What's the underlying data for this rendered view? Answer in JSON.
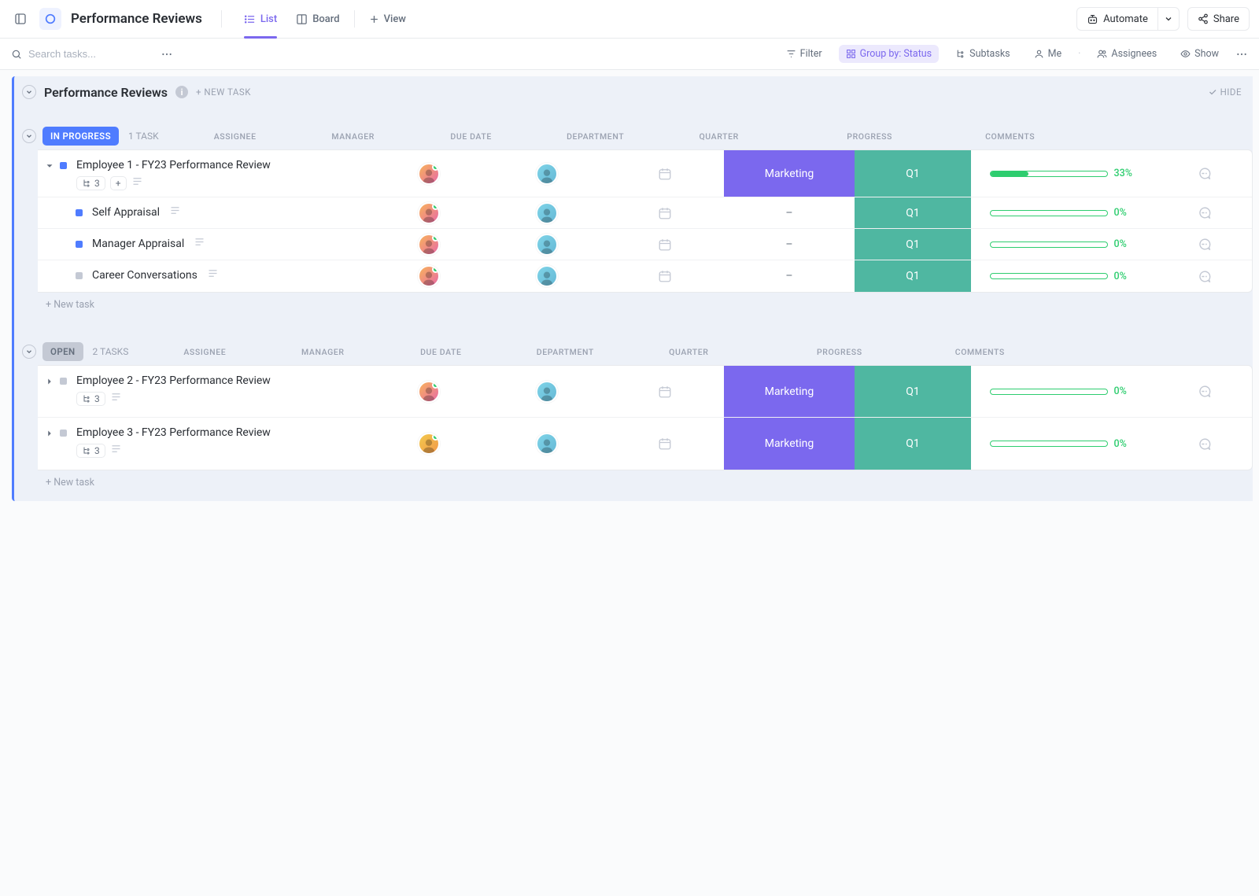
{
  "header": {
    "title": "Performance Reviews",
    "tabs": {
      "list": "List",
      "board": "Board",
      "view": "View"
    },
    "automate": "Automate",
    "share": "Share"
  },
  "toolbar": {
    "search_placeholder": "Search tasks...",
    "filter": "Filter",
    "group": "Group by: Status",
    "subtasks": "Subtasks",
    "me": "Me",
    "assignees": "Assignees",
    "show": "Show"
  },
  "list": {
    "title": "Performance Reviews",
    "new_task": "+ NEW TASK",
    "hide": "HIDE"
  },
  "columns": {
    "assignee": "ASSIGNEE",
    "manager": "MANAGER",
    "due": "DUE DATE",
    "dept": "DEPARTMENT",
    "qtr": "QUARTER",
    "prog": "PROGRESS",
    "comm": "COMMENTS"
  },
  "groups": [
    {
      "status": "IN PROGRESS",
      "color": "#4f7cff",
      "count": "1 TASK",
      "tasks": [
        {
          "name": "Employee 1 - FY23 Performance Review",
          "sub_count": "3",
          "dept": "Marketing",
          "dept_color": "#7b68ee",
          "qtr": "Q1",
          "qtr_color": "#4fb7a1",
          "pct": "33%",
          "pct_w": 33,
          "subs": [
            {
              "name": "Self Appraisal",
              "dept": "–",
              "qtr": "Q1",
              "pct": "0%",
              "sq": "inprog"
            },
            {
              "name": "Manager Appraisal",
              "dept": "–",
              "qtr": "Q1",
              "pct": "0%",
              "sq": "inprog"
            },
            {
              "name": "Career Conversations",
              "dept": "–",
              "qtr": "Q1",
              "pct": "0%",
              "sq": "cc"
            }
          ]
        }
      ],
      "new_task": "+ New task"
    },
    {
      "status": "OPEN",
      "color": "#c4c9d4",
      "count": "2 TASKS",
      "tasks": [
        {
          "name": "Employee 2 - FY23 Performance Review",
          "sub_count": "3",
          "dept": "Marketing",
          "dept_color": "#7b68ee",
          "qtr": "Q1",
          "qtr_color": "#4fb7a1",
          "pct": "0%",
          "pct_w": 0
        },
        {
          "name": "Employee 3 - FY23 Performance Review",
          "sub_count": "3",
          "dept": "Marketing",
          "dept_color": "#7b68ee",
          "qtr": "Q1",
          "qtr_color": "#4fb7a1",
          "pct": "0%",
          "pct_w": 0
        }
      ],
      "new_task": "+ New task"
    }
  ]
}
